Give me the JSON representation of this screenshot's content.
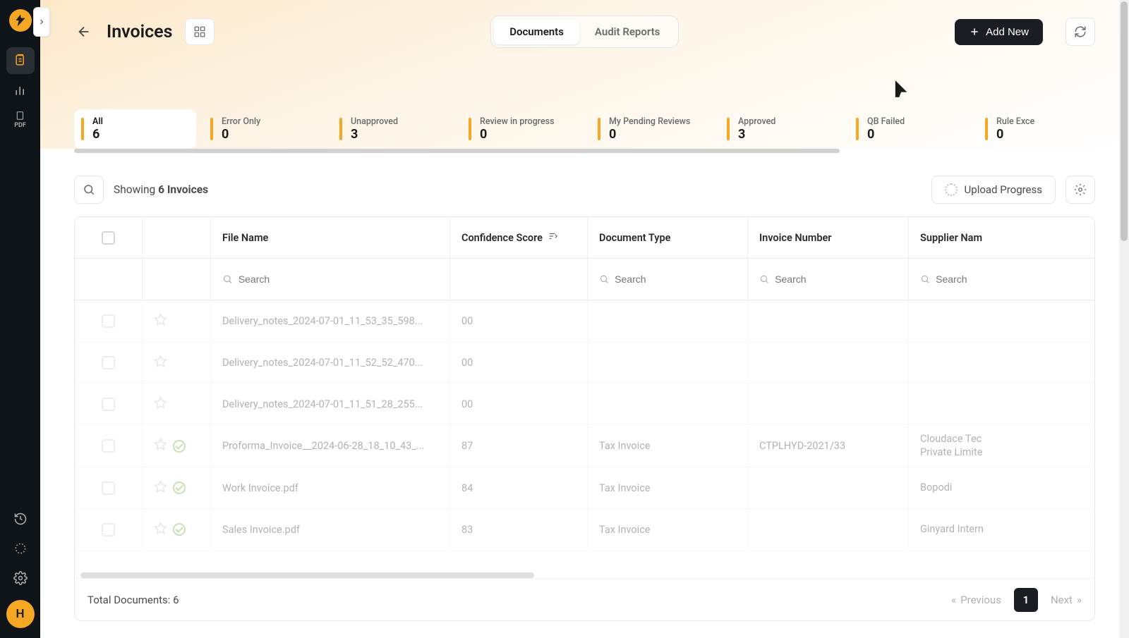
{
  "page_title": "Invoices",
  "toggle": {
    "documents": "Documents",
    "audit": "Audit Reports"
  },
  "add_new": "Add New",
  "filters": [
    {
      "label": "All",
      "count": "6",
      "active": true
    },
    {
      "label": "Error Only",
      "count": "0"
    },
    {
      "label": "Unapproved",
      "count": "3"
    },
    {
      "label": "Review in progress",
      "count": "0"
    },
    {
      "label": "My Pending Reviews",
      "count": "0"
    },
    {
      "label": "Approved",
      "count": "3"
    },
    {
      "label": "QB Failed",
      "count": "0"
    },
    {
      "label": "Rule Exce",
      "count": "0"
    }
  ],
  "showing_prefix": "Showing ",
  "showing_bold": "6 Invoices",
  "upload_progress": "Upload Progress",
  "columns": {
    "file_name": "File Name",
    "confidence": "Confidence Score",
    "doc_type": "Document Type",
    "invoice_no": "Invoice Number",
    "supplier": "Supplier Nam"
  },
  "search_ph": "Search",
  "rows": [
    {
      "file": "Delivery_notes_2024-07-01_11_53_35_598...",
      "score": "00",
      "type": "",
      "inv": "",
      "sup": "",
      "check": false
    },
    {
      "file": "Delivery_notes_2024-07-01_11_52_52_470...",
      "score": "00",
      "type": "",
      "inv": "",
      "sup": "",
      "check": false
    },
    {
      "file": "Delivery_notes_2024-07-01_11_51_28_255...",
      "score": "00",
      "type": "",
      "inv": "",
      "sup": "",
      "check": false
    },
    {
      "file": "Proforma_Invoice__2024-06-28_18_10_43_...",
      "score": "87",
      "type": "Tax Invoice",
      "inv": "CTPLHYD-2021/33",
      "sup": "Cloudace Tec\nPrivate Limite",
      "check": true
    },
    {
      "file": "Work Invoice.pdf",
      "score": "84",
      "type": "Tax Invoice",
      "inv": "",
      "sup": "Bopodi",
      "check": true
    },
    {
      "file": "Sales Invoice.pdf",
      "score": "83",
      "type": "Tax Invoice",
      "inv": "",
      "sup": "Ginyard Intern",
      "check": true
    }
  ],
  "total_label": "Total Documents: 6",
  "pager": {
    "prev": "Previous",
    "current": "1",
    "next": "Next"
  },
  "avatar": "H"
}
